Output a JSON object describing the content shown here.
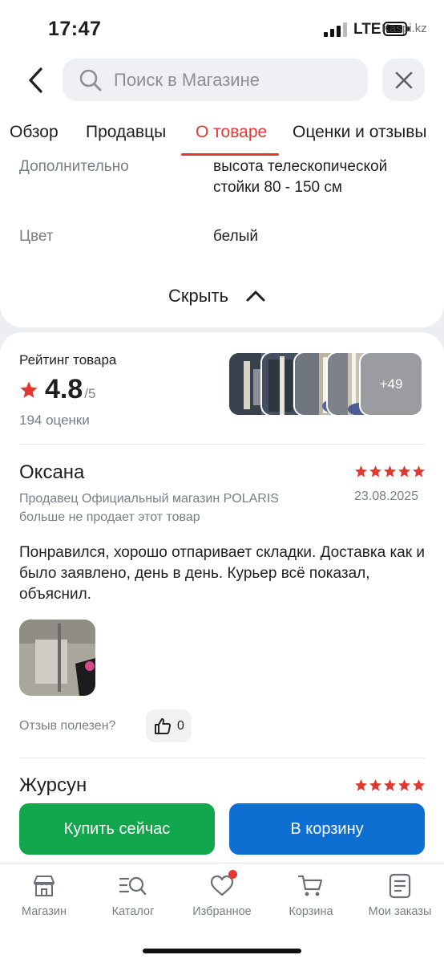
{
  "status_bar": {
    "time": "17:47",
    "network": "LTE",
    "watermark": "Kaspi.kz"
  },
  "header": {
    "back_icon": "chevron-left-icon",
    "search_placeholder": "Поиск в Магазине",
    "close_icon": "close-icon"
  },
  "tabs": [
    {
      "label": "Обзор",
      "active": false
    },
    {
      "label": "Продавцы",
      "active": false
    },
    {
      "label": "О товаре",
      "active": true
    },
    {
      "label": "Оценки и отзывы",
      "active": false
    }
  ],
  "specs": [
    {
      "label": "Дополнительно",
      "value": "высота телескопической стойки 80 - 150 см"
    },
    {
      "label": "Цвет",
      "value": "белый"
    }
  ],
  "collapse_label": "Скрыть",
  "rating": {
    "title": "Рейтинг товара",
    "value": "4.8",
    "max": "/5",
    "count": "194 оценки",
    "more_photos": "+49"
  },
  "reviews": [
    {
      "author": "Оксана",
      "stars": 5,
      "seller_note": "Продавец Официальный магазин POLARIS больше не продает этот товар",
      "date": "23.08.2025",
      "text": "Понравился, хорошо отпаривает складки. Доставка как и было заявлено, день в день. Курьер всё показал, объяснил.",
      "helpful_label": "Отзыв полезен?",
      "likes": "0"
    },
    {
      "author": "Журсун",
      "stars": 5
    }
  ],
  "actions": {
    "buy_now": "Купить сейчас",
    "to_cart": "В корзину"
  },
  "colors": {
    "accent": "#e3382f",
    "buy_now": "#12a74d",
    "to_cart": "#0d6fd1"
  },
  "bottom_nav": [
    {
      "label": "Магазин",
      "icon": "store-icon"
    },
    {
      "label": "Каталог",
      "icon": "catalog-search-icon"
    },
    {
      "label": "Избранное",
      "icon": "heart-icon",
      "badge": true
    },
    {
      "label": "Корзина",
      "icon": "cart-icon"
    },
    {
      "label": "Мои заказы",
      "icon": "orders-icon"
    }
  ]
}
